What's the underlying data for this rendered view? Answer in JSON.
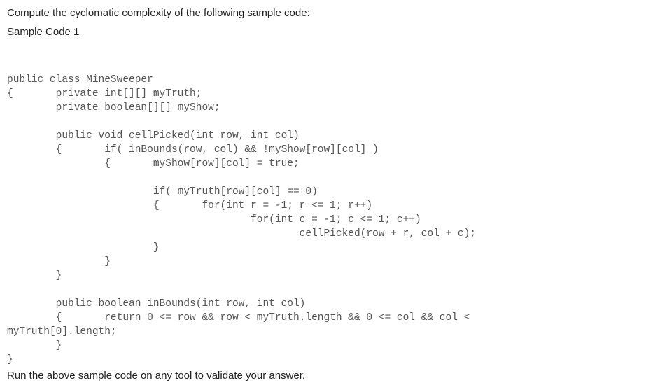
{
  "intro": {
    "line1": "Compute the cyclomatic complexity of the following sample code:",
    "line2": "Sample Code 1"
  },
  "code": {
    "l1": "public class MineSweeper",
    "l2": "{       private int[][] myTruth;",
    "l3": "        private boolean[][] myShow;",
    "l4": "",
    "l5": "        public void cellPicked(int row, int col)",
    "l6": "        {       if( inBounds(row, col) && !myShow[row][col] )",
    "l7": "                {       myShow[row][col] = true;",
    "l8": "",
    "l9": "                        if( myTruth[row][col] == 0)",
    "l10": "                        {       for(int r = -1; r <= 1; r++)",
    "l11": "                                        for(int c = -1; c <= 1; c++)",
    "l12": "                                                cellPicked(row + r, col + c);",
    "l13": "                        }",
    "l14": "                }",
    "l15": "        }",
    "l16": "",
    "l17": "        public boolean inBounds(int row, int col)",
    "l18": "        {       return 0 <= row && row < myTruth.length && 0 <= col && col <",
    "l19": "myTruth[0].length;",
    "l20": "        }",
    "l21": "}"
  },
  "footer": {
    "text": "Run the above sample code on any tool to validate your answer."
  }
}
